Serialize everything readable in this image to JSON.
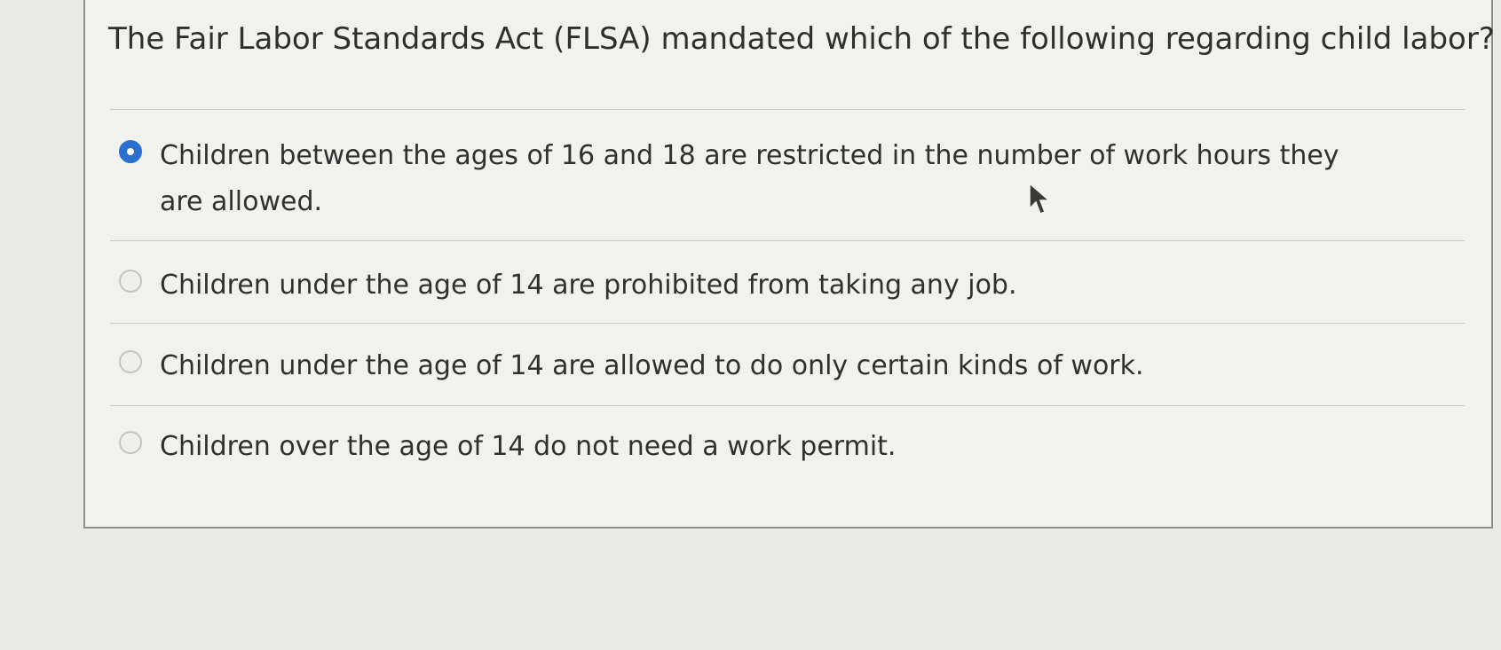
{
  "question": {
    "text": "The Fair Labor Standards Act (FLSA) mandated which of the following regarding child labor?"
  },
  "options": [
    {
      "label": "Children between the ages of 16 and 18 are restricted in the number of work hours they are allowed.",
      "selected": true
    },
    {
      "label": "Children under the age of 14 are prohibited from taking any job.",
      "selected": false
    },
    {
      "label": "Children under the age of 14 are allowed to do only certain kinds of work.",
      "selected": false
    },
    {
      "label": "Children over the age of 14 do not need a work permit.",
      "selected": false
    }
  ],
  "colors": {
    "selected_radio": "#2b6fcf",
    "background": "#e9e9e6"
  }
}
